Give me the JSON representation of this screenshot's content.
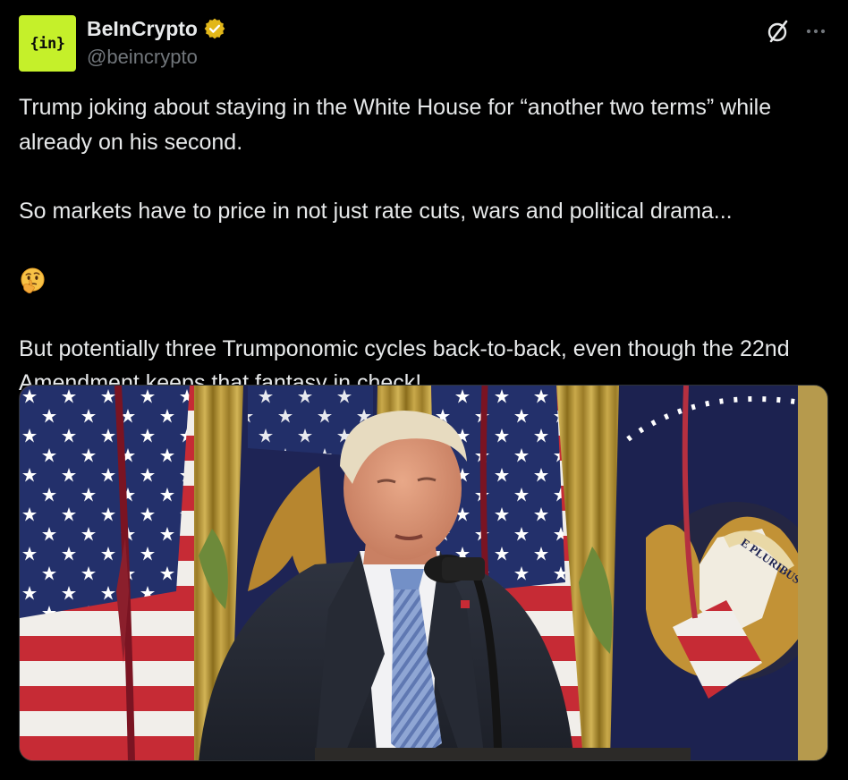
{
  "author": {
    "display_name": "BeInCrypto",
    "handle": "@beincrypto",
    "avatar_text": "{in}",
    "avatar_color": "#c5f02a",
    "verified": true,
    "verified_badge_color": "#e2b719"
  },
  "header_actions": {
    "grok_icon": "grok-icon",
    "more_icon": "more-icon"
  },
  "tweet": {
    "paragraph_1": "Trump joking about staying in the White House for “another two terms” while already on his second.",
    "paragraph_2": "So markets have to price in not just rate cuts, wars and political drama...",
    "paragraph_2_emoji": "thinking-face-emoji",
    "paragraph_3": "But potentially three Trumponomic cycles back-to-back, even though the 22nd Amendment keeps that fantasy in check!"
  },
  "media": {
    "type": "video-still",
    "seal_text": "E PLURIBUS UNU"
  },
  "colors": {
    "background": "#000000",
    "text_primary": "#e7e9ea",
    "text_secondary": "#71767b"
  }
}
